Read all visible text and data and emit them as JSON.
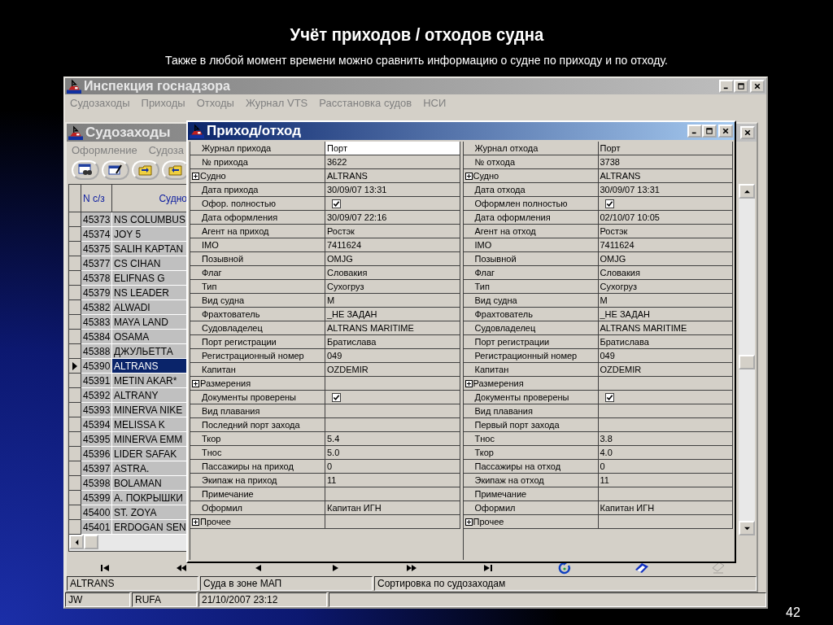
{
  "slide": {
    "title": "Учёт приходов / отходов судна",
    "subtitle": "Также в любой момент времени можно сравнить информацию о судне по приходу и по отходу.",
    "page_number": "42"
  },
  "main_window": {
    "title": "Инспекция госнадзора",
    "menu": [
      "Судозаходы",
      "Приходы",
      "Отходы",
      "Журнал VTS",
      "Расстановка судов",
      "НСИ"
    ],
    "status_bar": [
      "JW",
      "RUFA",
      "21/10/2007 23:12"
    ]
  },
  "ship_calls_window": {
    "title": "Судозаходы",
    "menu": [
      "Оформление",
      "Судоза"
    ],
    "columns": [
      "N с/з",
      "Судно"
    ],
    "rows": [
      {
        "number": "45373",
        "ship": "NS COLUMBUS",
        "selected": false
      },
      {
        "number": "45374",
        "ship": "JOY 5",
        "selected": false
      },
      {
        "number": "45375",
        "ship": "SALIH KAPTAN",
        "selected": false
      },
      {
        "number": "45377",
        "ship": "CS CIHAN",
        "selected": false
      },
      {
        "number": "45378",
        "ship": "ELIFNAS G",
        "selected": false
      },
      {
        "number": "45379",
        "ship": "NS LEADER",
        "selected": false
      },
      {
        "number": "45382",
        "ship": "ALWADI",
        "selected": false
      },
      {
        "number": "45383",
        "ship": "MAYA LAND",
        "selected": false
      },
      {
        "number": "45384",
        "ship": "OSAMA",
        "selected": false
      },
      {
        "number": "45388",
        "ship": "ДЖУЛЬЕТТА",
        "selected": false
      },
      {
        "number": "45390",
        "ship": "ALTRANS",
        "selected": true
      },
      {
        "number": "45391",
        "ship": "METIN AKAR*",
        "selected": false
      },
      {
        "number": "45392",
        "ship": "ALTRANY",
        "selected": false
      },
      {
        "number": "45393",
        "ship": "MINERVA NIKE",
        "selected": false
      },
      {
        "number": "45394",
        "ship": "MELISSA K",
        "selected": false
      },
      {
        "number": "45395",
        "ship": "MINERVA EMM",
        "selected": false
      },
      {
        "number": "45396",
        "ship": "LIDER SAFAK",
        "selected": false
      },
      {
        "number": "45397",
        "ship": "ASTRA.",
        "selected": false
      },
      {
        "number": "45398",
        "ship": "BOLAMAN",
        "selected": false
      },
      {
        "number": "45399",
        "ship": "A. ПОКРЫШКИ",
        "selected": false
      },
      {
        "number": "45400",
        "ship": "ST. ZOYA",
        "selected": false
      },
      {
        "number": "45401",
        "ship": "ERDOGAN SEN",
        "selected": false
      }
    ],
    "navigator": [
      {
        "kind": "first",
        "disabled": false
      },
      {
        "kind": "prior_page",
        "disabled": false
      },
      {
        "kind": "prior",
        "disabled": false
      },
      {
        "kind": "next",
        "disabled": false
      },
      {
        "kind": "next_page",
        "disabled": false
      },
      {
        "kind": "last",
        "disabled": false
      },
      {
        "kind": "refresh",
        "disabled": false
      },
      {
        "kind": "edit",
        "disabled": false
      },
      {
        "kind": "post",
        "disabled": true
      }
    ],
    "status_bar": [
      "ALTRANS",
      "Суда в зоне МАП",
      "Сортировка по судозаходам"
    ]
  },
  "dialog": {
    "title": "Приход/отход",
    "arrival": [
      {
        "kind": "edit",
        "label": "Журнал прихода",
        "value": "Порт"
      },
      {
        "kind": "text",
        "label": "№ прихода",
        "value": "3622"
      },
      {
        "kind": "group",
        "label": "Судно",
        "value": "ALTRANS",
        "expanded": false
      },
      {
        "kind": "text",
        "label": "Дата прихода",
        "value": "30/09/07 13:31"
      },
      {
        "kind": "check",
        "label": "Офор. полностью",
        "checked": true
      },
      {
        "kind": "text",
        "label": "Дата оформления",
        "value": "30/09/07 22:16"
      },
      {
        "kind": "text",
        "label": "Агент на приход",
        "value": "Ростэк"
      },
      {
        "kind": "text",
        "label": "IMO",
        "value": "7411624"
      },
      {
        "kind": "text",
        "label": "Позывной",
        "value": "OMJG"
      },
      {
        "kind": "text",
        "label": "Флаг",
        "value": "Словакия"
      },
      {
        "kind": "text",
        "label": "Тип",
        "value": "Сухогруз"
      },
      {
        "kind": "text",
        "label": "Вид судна",
        "value": "М"
      },
      {
        "kind": "text",
        "label": "Фрахтователь",
        "value": "_НЕ ЗАДАН"
      },
      {
        "kind": "text",
        "label": "Судовладелец",
        "value": "ALTRANS MARITIME"
      },
      {
        "kind": "text",
        "label": "Порт регистрации",
        "value": "Братислава"
      },
      {
        "kind": "text",
        "label": "Регистрационный номер",
        "value": "049"
      },
      {
        "kind": "text",
        "label": "Капитан",
        "value": "OZDEMIR"
      },
      {
        "kind": "group",
        "label": "Размерения",
        "expanded": false
      },
      {
        "kind": "check",
        "label": "Документы проверены",
        "checked": true
      },
      {
        "kind": "text",
        "label": "Вид плавания"
      },
      {
        "kind": "text",
        "label": "Последний порт захода"
      },
      {
        "kind": "text",
        "label": "Ткор",
        "value": "5.4"
      },
      {
        "kind": "text",
        "label": "Тнос",
        "value": "5.0"
      },
      {
        "kind": "text",
        "label": "Пассажиры на приход",
        "value": "0"
      },
      {
        "kind": "text",
        "label": "Экипаж на приход",
        "value": "11"
      },
      {
        "kind": "text",
        "label": "Примечание"
      },
      {
        "kind": "text",
        "label": "Оформил",
        "value": "Капитан ИГН"
      },
      {
        "kind": "group",
        "label": "Прочее",
        "expanded": false
      }
    ],
    "departure": [
      {
        "kind": "text",
        "label": "Журнал отхода",
        "value": "Порт"
      },
      {
        "kind": "text",
        "label": "№ отхода",
        "value": "3738"
      },
      {
        "kind": "group",
        "label": "Судно",
        "value": "ALTRANS",
        "expanded": false
      },
      {
        "kind": "text",
        "label": "Дата отхода",
        "value": "30/09/07 13:31"
      },
      {
        "kind": "check",
        "label": "Оформлен полностью",
        "checked": true
      },
      {
        "kind": "text",
        "label": "Дата оформления",
        "value": "02/10/07 10:05"
      },
      {
        "kind": "text",
        "label": "Агент на отход",
        "value": "Ростэк"
      },
      {
        "kind": "text",
        "label": "IMO",
        "value": "7411624"
      },
      {
        "kind": "text",
        "label": "Позывной",
        "value": "OMJG"
      },
      {
        "kind": "text",
        "label": "Флаг",
        "value": "Словакия"
      },
      {
        "kind": "text",
        "label": "Тип",
        "value": "Сухогруз"
      },
      {
        "kind": "text",
        "label": "Вид судна",
        "value": "М"
      },
      {
        "kind": "text",
        "label": "Фрахтователь",
        "value": "_НЕ ЗАДАН"
      },
      {
        "kind": "text",
        "label": "Судовладелец",
        "value": "ALTRANS MARITIME"
      },
      {
        "kind": "text",
        "label": "Порт регистрации",
        "value": "Братислава"
      },
      {
        "kind": "text",
        "label": "Регистрационный номер",
        "value": "049"
      },
      {
        "kind": "text",
        "label": "Капитан",
        "value": "OZDEMIR"
      },
      {
        "kind": "group",
        "label": "Размерения",
        "expanded": false
      },
      {
        "kind": "check",
        "label": "Документы проверены",
        "checked": true
      },
      {
        "kind": "text",
        "label": "Вид плавания"
      },
      {
        "kind": "text",
        "label": "Первый порт захода"
      },
      {
        "kind": "text",
        "label": "Тнос",
        "value": "3.8"
      },
      {
        "kind": "text",
        "label": "Ткор",
        "value": "4.0"
      },
      {
        "kind": "text",
        "label": "Пассажиры на отход",
        "value": "0"
      },
      {
        "kind": "text",
        "label": "Экипаж на отход",
        "value": "11"
      },
      {
        "kind": "text",
        "label": "Примечание"
      },
      {
        "kind": "text",
        "label": "Оформил",
        "value": "Капитан ИГН"
      },
      {
        "kind": "group",
        "label": "Прочее",
        "expanded": false
      }
    ]
  }
}
